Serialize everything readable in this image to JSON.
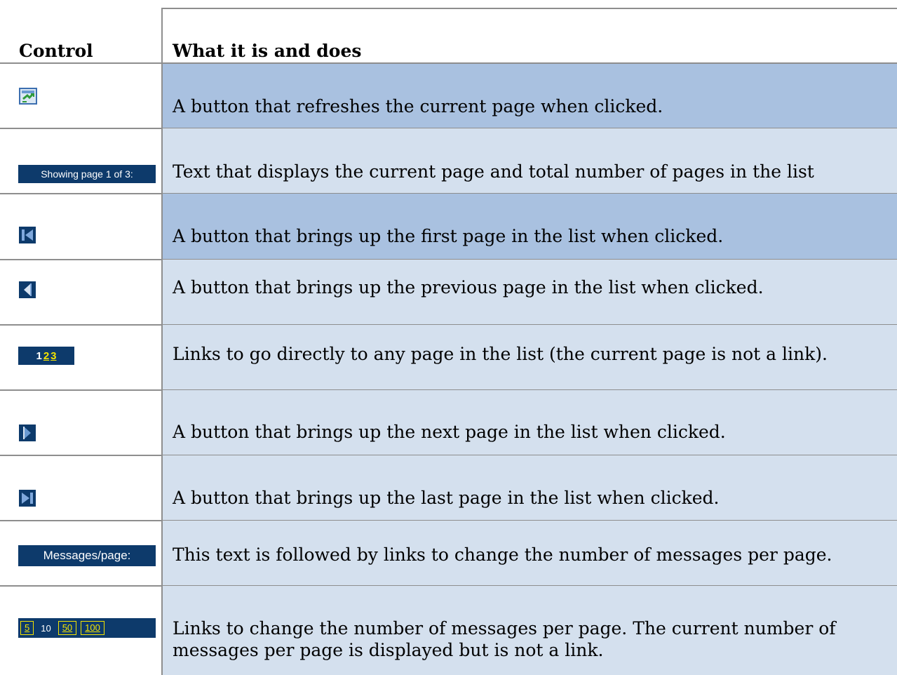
{
  "header": {
    "col1": "Control",
    "col2": "What it is and does"
  },
  "rows": [
    {
      "icon": "refresh-icon",
      "desc": "A button that refreshes the current page when clicked."
    },
    {
      "label": "Showing page 1 of 3:",
      "desc": "Text that displays the current page and total number of pages in the list"
    },
    {
      "icon": "first-page-icon",
      "desc": "A button that brings up the first page in the list when clicked."
    },
    {
      "icon": "previous-page-icon",
      "desc": "A button that brings up the previous page in the list when clicked."
    },
    {
      "pages": [
        "1",
        "2",
        "3"
      ],
      "current_page": "1",
      "desc": "Links to go directly to any page in the list (the current page is not a link)."
    },
    {
      "icon": "next-page-icon",
      "desc": "A button that brings up the next page in the list when clicked."
    },
    {
      "icon": "last-page-icon",
      "desc": "A button that brings up the last page in the list when clicked."
    },
    {
      "label": "Messages/page:",
      "desc": "This text is followed by links to change the number of messages per page."
    },
    {
      "options": [
        "5",
        "10",
        "50",
        "100"
      ],
      "current": "10",
      "desc_line1": "Links to change the number of messages per page. The current number of",
      "desc_line2": "messages per page is displayed but is not a link."
    }
  ],
  "colors": {
    "navy": "#0d3a6b",
    "link_yellow": "#f4e400",
    "row_light": "#d4e0ee",
    "row_dark": "#a9c1e0"
  }
}
